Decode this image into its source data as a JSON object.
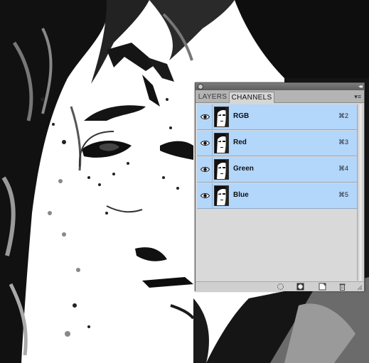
{
  "panel": {
    "tabs": [
      {
        "label": "LAYERS",
        "active": false
      },
      {
        "label": "CHANNELS",
        "active": true
      }
    ],
    "menu_icon": "panel-menu-icon",
    "collapse_icon": "collapse-icon"
  },
  "channels": [
    {
      "name": "RGB",
      "shortcut": "⌘2",
      "visible": true,
      "selected": true
    },
    {
      "name": "Red",
      "shortcut": "⌘3",
      "visible": true,
      "selected": true
    },
    {
      "name": "Green",
      "shortcut": "⌘4",
      "visible": true,
      "selected": true
    },
    {
      "name": "Blue",
      "shortcut": "⌘5",
      "visible": true,
      "selected": true
    }
  ],
  "footer_icons": [
    "load-selection-icon",
    "save-selection-icon",
    "new-channel-icon",
    "trash-icon"
  ],
  "colors": {
    "row_selected": "#b3d6fb",
    "panel_bg": "#d6d6d6"
  }
}
